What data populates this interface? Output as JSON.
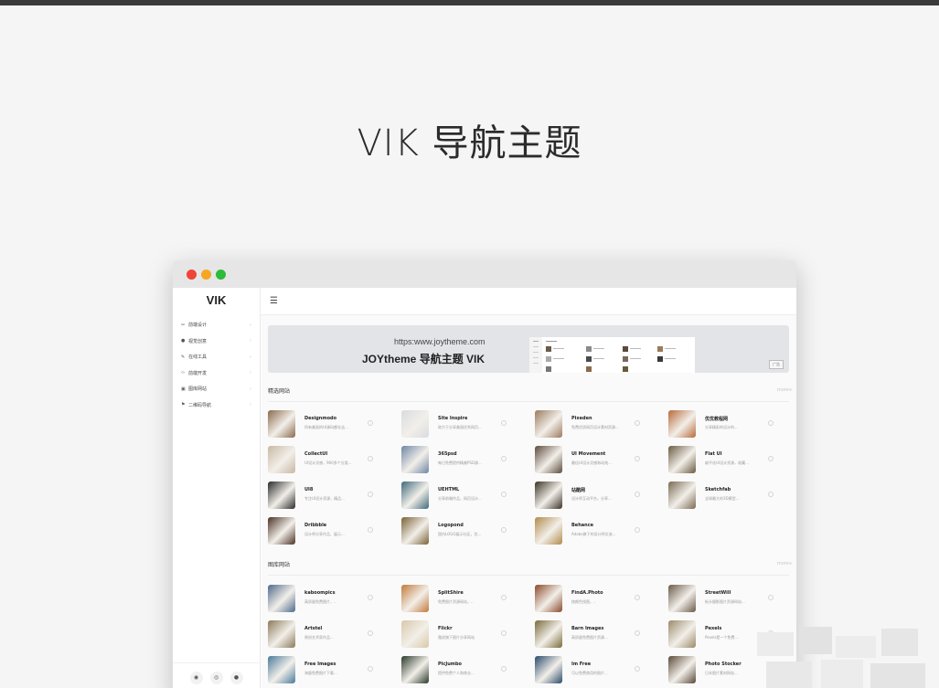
{
  "hero": {
    "title": "VIK 导航主题"
  },
  "window": {
    "controls": [
      {
        "name": "close",
        "color": "#f0433a"
      },
      {
        "name": "minimize",
        "color": "#f5a623"
      },
      {
        "name": "maximize",
        "color": "#2cbb3a"
      }
    ]
  },
  "sidebar": {
    "logo": "VIK",
    "items": [
      {
        "icon": "scissors-icon",
        "glyph": "✂",
        "label": "前端设计"
      },
      {
        "icon": "drop-icon",
        "glyph": "●",
        "label": "视觉创意"
      },
      {
        "icon": "pen-icon",
        "glyph": "✎",
        "label": "在线工具"
      },
      {
        "icon": "code-icon",
        "glyph": "‹›",
        "label": "前端开发"
      },
      {
        "icon": "image-icon",
        "glyph": "▣",
        "label": "图库网站"
      },
      {
        "icon": "flag-icon",
        "glyph": "⚑",
        "label": "二维码导航"
      }
    ],
    "bottom_buttons": [
      "bell-icon",
      "weibo-icon",
      "wechat-icon"
    ]
  },
  "banner": {
    "url": "https:www.joytheme.com",
    "title": "JOYtheme 导航主题 VIK",
    "ad": "广告"
  },
  "sections": [
    {
      "title": "精选网站",
      "more": "more+",
      "sites": [
        {
          "name": "Designmodo",
          "desc": "所有美丽的UI源码都在这...",
          "color": "#8a6a4c"
        },
        {
          "name": "Site Inspire",
          "desc": "致力于分享美丽优秀网页...",
          "color": "#d9dbe0"
        },
        {
          "name": "Pixeden",
          "desc": "免费优质网页设计素材资源...",
          "color": "#9a7a5e"
        },
        {
          "name": "优优教程网",
          "desc": "分享精彩的设计的...",
          "color": "#b86a3a"
        },
        {
          "name": "CollectUI",
          "desc": "UI设计灵感，900多个分类...",
          "color": "#c8b8a4"
        },
        {
          "name": "365psd",
          "desc": "每日免费提供精美PSD源...",
          "color": "#6f86a6"
        },
        {
          "name": "UI Movement",
          "desc": "最佳UI设计灵感和动效...",
          "color": "#5c4a3c"
        },
        {
          "name": "Flat UI",
          "desc": "扁平化UI设计资源，收藏...",
          "color": "#6a5a42"
        },
        {
          "name": "UI8",
          "desc": "专注UI设计资源，精品...",
          "color": "#2a2a2a"
        },
        {
          "name": "UEHTML",
          "desc": "分享前端作品，网页设计...",
          "color": "#3f6a7c"
        },
        {
          "name": "站酷网",
          "desc": "设计师互动平台，分享...",
          "color": "#3a3226"
        },
        {
          "name": "Sketchfab",
          "desc": "全球最大的3D模型...",
          "color": "#7a6a52"
        },
        {
          "name": "Dribbble",
          "desc": "设计师分享作品、展示...",
          "color": "#4a3224"
        },
        {
          "name": "Logopond",
          "desc": "国内LOGO展示社区，优...",
          "color": "#7a6236"
        },
        {
          "name": "Behance",
          "desc": "Adobe旗下的设计师交流...",
          "color": "#b08a4a"
        }
      ]
    },
    {
      "title": "图库网站",
      "more": "more+",
      "sites": [
        {
          "name": "kaboompics",
          "desc": "高质量免费图片，..",
          "color": "#4e6a8a"
        },
        {
          "name": "SplitShire",
          "desc": "免费图片资源网站，..",
          "color": "#c27a3a"
        },
        {
          "name": "FindA.Photo",
          "desc": "按颜色找图，..",
          "color": "#8a4a2a"
        },
        {
          "name": "StreetWill",
          "desc": "街头摄影图片资源网站...",
          "color": "#6a5a4a"
        },
        {
          "name": "Artstel",
          "desc": "原创艺术家作品...",
          "color": "#8a7a5a"
        },
        {
          "name": "Flickr",
          "desc": "雅虎旗下图片分享网站",
          "color": "#d8c8a8"
        },
        {
          "name": "Barn Images",
          "desc": "高质量免费图片资源...",
          "color": "#7a6a3a"
        },
        {
          "name": "Pexels",
          "desc": "Pexels是一个免费...",
          "color": "#9a8a6a"
        },
        {
          "name": "Free Images",
          "desc": "海量免费图片下载...",
          "color": "#4a7a9a"
        },
        {
          "name": "PicJumbo",
          "desc": "提供免费个人和商业...",
          "color": "#2a3a2a"
        },
        {
          "name": "Im Free",
          "desc": "可以免费商用的图片...",
          "color": "#2a4a6a"
        },
        {
          "name": "Photo Stocker",
          "desc": "日本图片素材网站...",
          "color": "#5a4a3a"
        }
      ]
    }
  ]
}
